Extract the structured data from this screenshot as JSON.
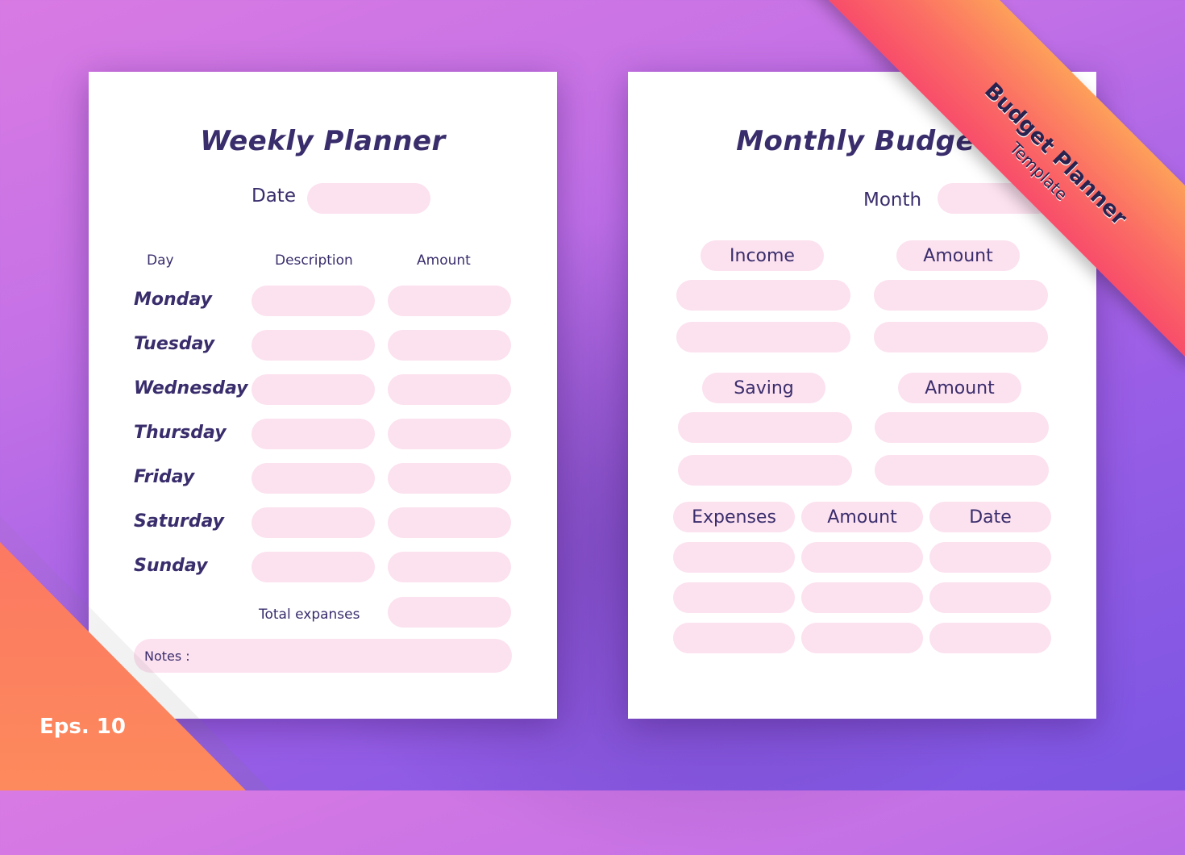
{
  "colors": {
    "background_top": "#d97ae3",
    "background_bottom": "#7b55e2",
    "ink": "#3a2d6c",
    "field_fill": "#fce1ef",
    "ribbon_top": "#fda05a",
    "ribbon_bottom": "#f84d6a",
    "page": "#ffffff"
  },
  "ribbon": {
    "title": "Budget Planner",
    "subtitle": "Template"
  },
  "badge": {
    "format_label": "Eps. 10"
  },
  "weekly": {
    "title": "Weekly Planner",
    "date_label": "Date",
    "columns": [
      "Day",
      "Description",
      "Amount"
    ],
    "days": [
      "Monday",
      "Tuesday",
      "Wednesday",
      "Thursday",
      "Friday",
      "Saturday",
      "Sunday"
    ],
    "total_label": "Total expanses",
    "notes_label": "Notes :"
  },
  "monthly": {
    "title": "Monthly Budget",
    "month_label": "Month",
    "income": {
      "label": "Income",
      "amount_label": "Amount",
      "rows": 2
    },
    "saving": {
      "label": "Saving",
      "amount_label": "Amount",
      "rows": 2
    },
    "expenses": {
      "label": "Expenses",
      "amount_label": "Amount",
      "date_label": "Date",
      "rows": 3
    }
  }
}
